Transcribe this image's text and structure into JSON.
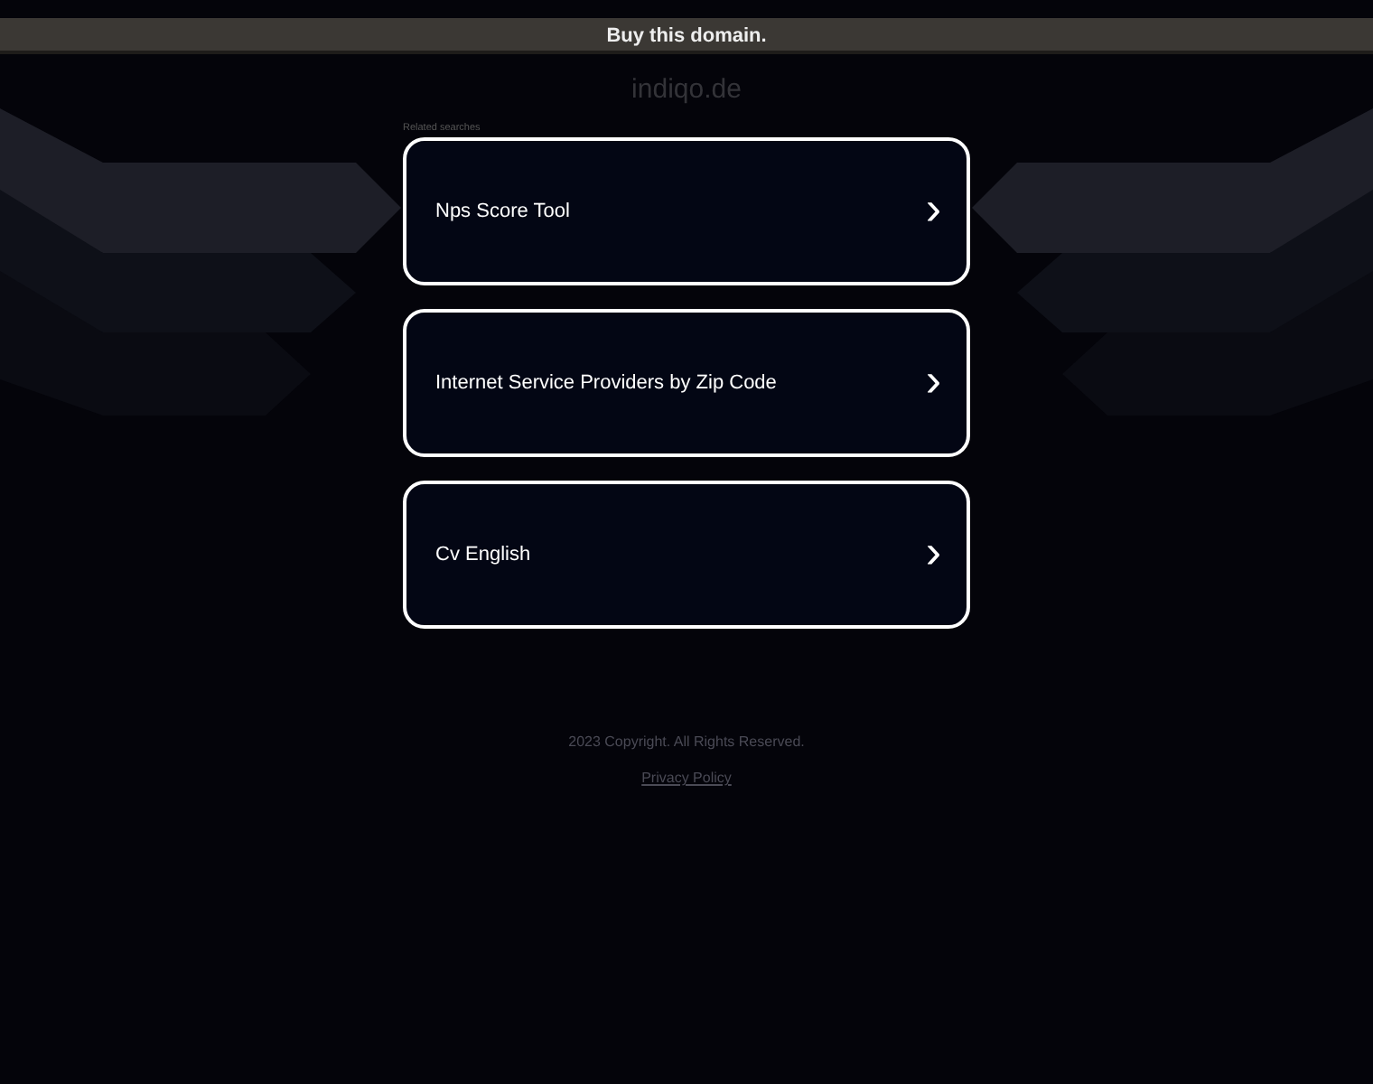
{
  "banner": {
    "text": "Buy this domain."
  },
  "domain": "indiqo.de",
  "related_label": "Related searches",
  "links": [
    {
      "label": "Nps Score Tool",
      "chevron": "›"
    },
    {
      "label": "Internet Service Providers by Zip Code",
      "chevron": "›"
    },
    {
      "label": "Cv English",
      "chevron": "›"
    }
  ],
  "footer": {
    "copyright": "2023 Copyright. All Rights Reserved.",
    "privacy": "Privacy Policy"
  }
}
